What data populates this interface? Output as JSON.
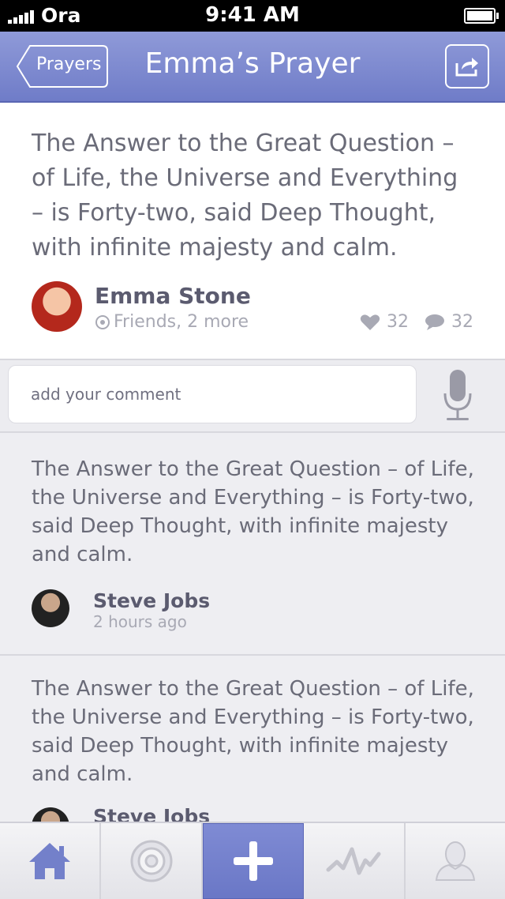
{
  "status_bar": {
    "carrier": "Ora",
    "time": "9:41 AM"
  },
  "nav": {
    "back_label": "Prayers",
    "title": "Emma’s Prayer"
  },
  "post": {
    "text": "The Answer to the Great Question – of Life, the Universe and Everything – is Forty-two, said Deep Thought, with infinite majesty and calm.",
    "author": "Emma Stone",
    "audience": "Friends, 2 more",
    "likes": "32",
    "comments": "32"
  },
  "comment_input": {
    "placeholder": "add your comment"
  },
  "comments": [
    {
      "text": "The Answer to the Great Question – of Life, the Universe and Everything – is Forty-two, said Deep Thought, with infinite majesty and calm.",
      "author": "Steve Jobs",
      "time": "2 hours ago"
    },
    {
      "text": "The Answer to the Great Question – of Life, the Universe and Everything – is Forty-two, said Deep Thought, with infinite majesty and calm.",
      "author": "Steve Jobs"
    }
  ],
  "tabs": [
    {
      "icon": "home-icon"
    },
    {
      "icon": "target-icon"
    },
    {
      "icon": "add-icon",
      "active": true
    },
    {
      "icon": "activity-icon"
    },
    {
      "icon": "profile-icon"
    }
  ],
  "colors": {
    "accent": "#7380ca",
    "text": "#6a6b78",
    "muted": "#a8a9b4"
  }
}
